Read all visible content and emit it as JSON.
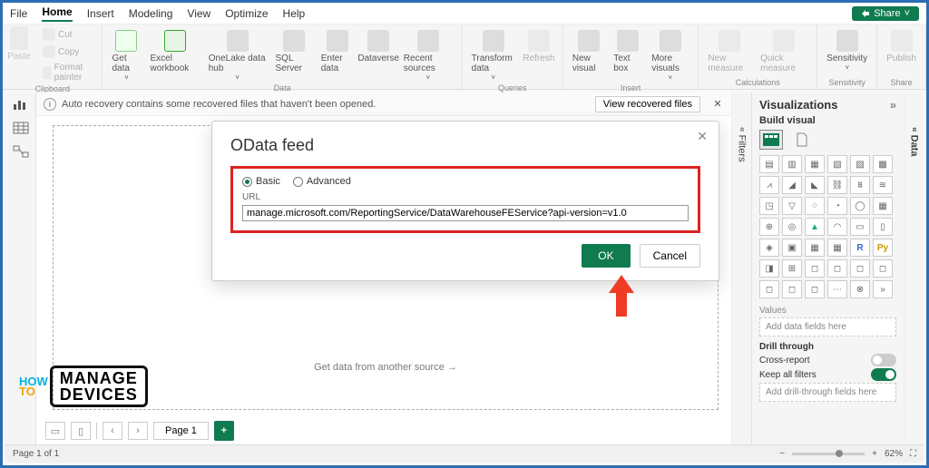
{
  "menu": {
    "items": [
      "File",
      "Home",
      "Insert",
      "Modeling",
      "View",
      "Optimize",
      "Help"
    ],
    "active": 1,
    "share": "Share"
  },
  "ribbon": {
    "clipboard": {
      "paste": "Paste",
      "cut": "Cut",
      "copy": "Copy",
      "format": "Format painter",
      "label": "Clipboard"
    },
    "data": {
      "get": "Get data",
      "excel": "Excel workbook",
      "onelake": "OneLake data hub",
      "sql": "SQL Server",
      "enter": "Enter data",
      "dataverse": "Dataverse",
      "recent": "Recent sources",
      "label": "Data"
    },
    "queries": {
      "transform": "Transform data",
      "refresh": "Refresh",
      "label": "Queries"
    },
    "insert": {
      "newvis": "New visual",
      "textbox": "Text box",
      "more": "More visuals",
      "label": "Insert"
    },
    "calc": {
      "newmeasure": "New measure",
      "quick": "Quick measure",
      "label": "Calculations"
    },
    "sens": {
      "sensitivity": "Sensitivity",
      "label": "Sensitivity"
    },
    "share": {
      "publish": "Publish",
      "label": "Share"
    }
  },
  "recovery": {
    "msg": "Auto recovery contains some recovered files that haven't been opened.",
    "btn": "View recovered files"
  },
  "canvas_hint": "Get data from another source →",
  "pages": {
    "page1": "Page 1",
    "status": "Page 1 of 1"
  },
  "dialog": {
    "title": "OData feed",
    "basic": "Basic",
    "advanced": "Advanced",
    "url_label": "URL",
    "url_value": "manage.microsoft.com/ReportingService/DataWarehouseFEService?api-version=v1.0",
    "ok": "OK",
    "cancel": "Cancel"
  },
  "viz": {
    "title": "Visualizations",
    "build": "Build visual",
    "values": "Values",
    "values_hint": "Add data fields here",
    "drill": "Drill through",
    "cross": "Cross-report",
    "keep": "Keep all filters",
    "drill_hint": "Add drill-through fields here",
    "off": "Off",
    "on": "On"
  },
  "filters_label": "Filters",
  "data_label": "Data",
  "zoom": "62%",
  "watermark": {
    "how": "HOW",
    "to": "TO",
    "line1": "MANAGE",
    "line2": "DEVICES"
  }
}
